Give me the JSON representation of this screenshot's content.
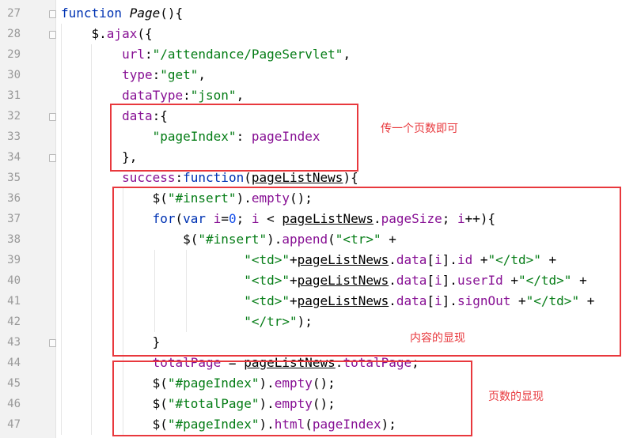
{
  "editor": {
    "line_numbers": [
      "27",
      "28",
      "29",
      "30",
      "31",
      "32",
      "33",
      "34",
      "35",
      "36",
      "37",
      "38",
      "39",
      "40",
      "41",
      "42",
      "43",
      "44",
      "45",
      "46",
      "47"
    ],
    "lines": [
      [
        [
          "kw",
          "function "
        ],
        [
          "fn",
          "Page"
        ],
        [
          "",
          "(){"
        ]
      ],
      [
        [
          "",
          "    $."
        ],
        [
          "prop",
          "ajax"
        ],
        [
          "",
          "({"
        ]
      ],
      [
        [
          "",
          "        "
        ],
        [
          "prop",
          "url"
        ],
        [
          "",
          ":"
        ],
        [
          "str",
          "\"/attendance/PageServlet\""
        ],
        [
          "",
          ","
        ]
      ],
      [
        [
          "",
          "        "
        ],
        [
          "prop",
          "type"
        ],
        [
          "",
          ":"
        ],
        [
          "str",
          "\"get\""
        ],
        [
          "",
          ","
        ]
      ],
      [
        [
          "",
          "        "
        ],
        [
          "prop",
          "dataType"
        ],
        [
          "",
          ":"
        ],
        [
          "str",
          "\"json\""
        ],
        [
          "",
          ","
        ]
      ],
      [
        [
          "",
          "        "
        ],
        [
          "prop",
          "data"
        ],
        [
          "",
          ":{"
        ]
      ],
      [
        [
          "",
          "            "
        ],
        [
          "str",
          "\"pageIndex\""
        ],
        [
          "",
          ": "
        ],
        [
          "prop",
          "pageIndex"
        ]
      ],
      [
        [
          "",
          "        },"
        ]
      ],
      [
        [
          "",
          "        "
        ],
        [
          "prop",
          "success"
        ],
        [
          "",
          ":"
        ],
        [
          "kw",
          "function"
        ],
        [
          "",
          "("
        ],
        [
          "ul",
          "pageListNews"
        ],
        [
          "",
          "){"
        ]
      ],
      [
        [
          "",
          "            $("
        ],
        [
          "str",
          "\"#insert\""
        ],
        [
          "",
          ")."
        ],
        [
          "prop",
          "empty"
        ],
        [
          "",
          "();"
        ]
      ],
      [
        [
          "",
          "            "
        ],
        [
          "kw",
          "for"
        ],
        [
          "",
          "("
        ],
        [
          "kw",
          "var "
        ],
        [
          "prop",
          "i"
        ],
        [
          "",
          "="
        ],
        [
          "num",
          "0"
        ],
        [
          "",
          "; "
        ],
        [
          "prop",
          "i"
        ],
        [
          "",
          " < "
        ],
        [
          "ul",
          "pageListNews"
        ],
        [
          "",
          "."
        ],
        [
          "prop",
          "pageSize"
        ],
        [
          "",
          "; "
        ],
        [
          "prop",
          "i"
        ],
        [
          "",
          "++){"
        ]
      ],
      [
        [
          "",
          "                $("
        ],
        [
          "str",
          "\"#insert\""
        ],
        [
          "",
          ")."
        ],
        [
          "prop",
          "append"
        ],
        [
          "",
          "("
        ],
        [
          "str",
          "\"<tr>\""
        ],
        [
          "",
          " +"
        ]
      ],
      [
        [
          "",
          "                        "
        ],
        [
          "str",
          "\"<td>\""
        ],
        [
          "",
          "+"
        ],
        [
          "ul",
          "pageListNews"
        ],
        [
          "",
          "."
        ],
        [
          "prop",
          "data"
        ],
        [
          "",
          "["
        ],
        [
          "prop",
          "i"
        ],
        [
          "",
          "]."
        ],
        [
          "prop",
          "id"
        ],
        [
          "",
          " +"
        ],
        [
          "str",
          "\"</td>\""
        ],
        [
          "",
          " +"
        ]
      ],
      [
        [
          "",
          "                        "
        ],
        [
          "str",
          "\"<td>\""
        ],
        [
          "",
          "+"
        ],
        [
          "ul",
          "pageListNews"
        ],
        [
          "",
          "."
        ],
        [
          "prop",
          "data"
        ],
        [
          "",
          "["
        ],
        [
          "prop",
          "i"
        ],
        [
          "",
          "]."
        ],
        [
          "prop",
          "userId"
        ],
        [
          "",
          " +"
        ],
        [
          "str",
          "\"</td>\""
        ],
        [
          "",
          " +"
        ]
      ],
      [
        [
          "",
          "                        "
        ],
        [
          "str",
          "\"<td>\""
        ],
        [
          "",
          "+"
        ],
        [
          "ul",
          "pageListNews"
        ],
        [
          "",
          "."
        ],
        [
          "prop",
          "data"
        ],
        [
          "",
          "["
        ],
        [
          "prop",
          "i"
        ],
        [
          "",
          "]."
        ],
        [
          "prop",
          "signOut"
        ],
        [
          "",
          " +"
        ],
        [
          "str",
          "\"</td>\""
        ],
        [
          "",
          " +"
        ]
      ],
      [
        [
          "",
          "                        "
        ],
        [
          "str",
          "\"</tr>\""
        ],
        [
          "",
          ");"
        ]
      ],
      [
        [
          "",
          "            }"
        ]
      ],
      [
        [
          "",
          "            "
        ],
        [
          "prop",
          "totalPage"
        ],
        [
          "",
          " = "
        ],
        [
          "ul",
          "pageListNews"
        ],
        [
          "",
          "."
        ],
        [
          "prop",
          "totalPage"
        ],
        [
          "",
          ";"
        ]
      ],
      [
        [
          "",
          "            $("
        ],
        [
          "str",
          "\"#pageIndex\""
        ],
        [
          "",
          ")."
        ],
        [
          "prop",
          "empty"
        ],
        [
          "",
          "();"
        ]
      ],
      [
        [
          "",
          "            $("
        ],
        [
          "str",
          "\"#totalPage\""
        ],
        [
          "",
          ")."
        ],
        [
          "prop",
          "empty"
        ],
        [
          "",
          "();"
        ]
      ],
      [
        [
          "",
          "            $("
        ],
        [
          "str",
          "\"#pageIndex\""
        ],
        [
          "",
          ")."
        ],
        [
          "prop",
          "html"
        ],
        [
          "",
          "("
        ],
        [
          "prop",
          "pageIndex"
        ],
        [
          "",
          ");"
        ]
      ]
    ]
  },
  "annotations": {
    "data_note": "传一个页数即可",
    "content_note": "内容的显现",
    "page_note": "页数的显现"
  },
  "colors": {
    "keyword": "#0033b3",
    "string": "#067d17",
    "property": "#871094",
    "number": "#1750eb",
    "annotation": "#e8383d"
  }
}
